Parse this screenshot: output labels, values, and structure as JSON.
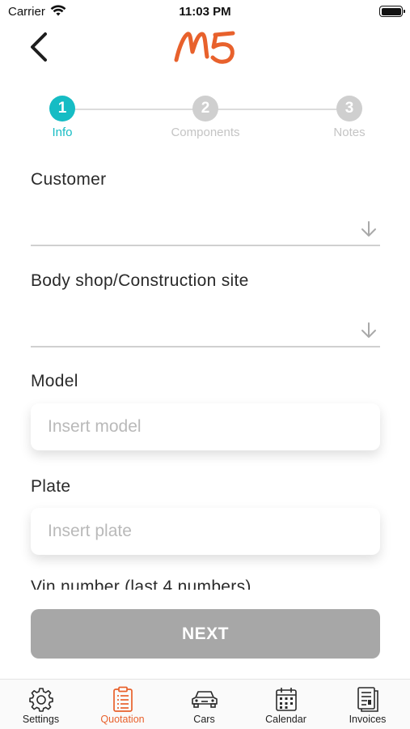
{
  "status_bar": {
    "carrier": "Carrier",
    "time": "11:03 PM"
  },
  "header": {
    "logo_text": "M5",
    "back_icon": "chevron-left-icon"
  },
  "stepper": {
    "steps": [
      {
        "number": "1",
        "label": "Info",
        "active": true
      },
      {
        "number": "2",
        "label": "Components",
        "active": false
      },
      {
        "number": "3",
        "label": "Notes",
        "active": false
      }
    ]
  },
  "form": {
    "customer": {
      "label": "Customer",
      "value": ""
    },
    "body_shop": {
      "label": "Body shop/Construction site",
      "value": ""
    },
    "model": {
      "label": "Model",
      "placeholder": "Insert model",
      "value": ""
    },
    "plate": {
      "label": "Plate",
      "placeholder": "Insert plate",
      "value": ""
    },
    "vin": {
      "label": "Vin number (last 4 numbers)"
    }
  },
  "next_button": {
    "label": "NEXT"
  },
  "tab_bar": {
    "tabs": [
      {
        "label": "Settings",
        "icon": "gear-icon",
        "active": false
      },
      {
        "label": "Quotation",
        "icon": "clipboard-icon",
        "active": true
      },
      {
        "label": "Cars",
        "icon": "car-icon",
        "active": false
      },
      {
        "label": "Calendar",
        "icon": "calendar-icon",
        "active": false
      },
      {
        "label": "Invoices",
        "icon": "invoice-icon",
        "active": false
      }
    ]
  },
  "colors": {
    "accent": "#16bcc4",
    "brand": "#e8612c",
    "button_disabled": "#a7a7a7"
  }
}
